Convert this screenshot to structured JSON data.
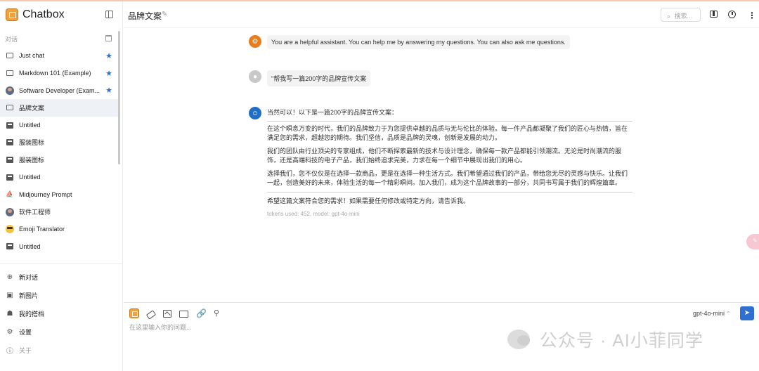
{
  "app": {
    "name": "Chatbox"
  },
  "sidebar": {
    "section_label": "对话",
    "conversations": [
      {
        "label": "Just chat",
        "icon": "chat-bubble-icon",
        "starred": true,
        "active": false
      },
      {
        "label": "Markdown 101 (Example)",
        "icon": "chat-bubble-icon",
        "starred": true,
        "active": false
      },
      {
        "label": "Software Developer (Exam...",
        "icon": "avatar-icon",
        "starred": true,
        "active": false
      },
      {
        "label": "品牌文案",
        "icon": "chat-bubble-icon",
        "starred": false,
        "active": true
      },
      {
        "label": "Untitled",
        "icon": "image-icon",
        "starred": false,
        "active": false
      },
      {
        "label": "服装图标",
        "icon": "image-icon",
        "starred": false,
        "active": false
      },
      {
        "label": "服装图标",
        "icon": "image-icon",
        "starred": false,
        "active": false
      },
      {
        "label": "Untitled",
        "icon": "image-icon",
        "starred": false,
        "active": false
      },
      {
        "label": "Midjourney Prompt",
        "icon": "midjourney-icon",
        "starred": false,
        "active": false
      },
      {
        "label": "软件工程师",
        "icon": "avatar-icon",
        "starred": false,
        "active": false
      },
      {
        "label": "Emoji Translator",
        "icon": "emoji-icon",
        "starred": false,
        "active": false
      },
      {
        "label": "Untitled",
        "icon": "image-icon",
        "starred": false,
        "active": false
      }
    ],
    "menu": {
      "new_chat": "新对话",
      "new_image": "新图片",
      "my_partners": "我的搭档",
      "settings": "设置",
      "about": "关于"
    }
  },
  "header": {
    "title": "品牌文案",
    "search_placeholder": "搜索..."
  },
  "messages": {
    "system": "You are a helpful assistant. You can help me by answering my questions. You can also ask me questions.",
    "user": "\"帮我写一篇200字的品牌宣传文案",
    "assistant": {
      "intro": "当然可以！以下是一篇200字的品牌宣传文案：",
      "paragraphs": [
        "在这个瞬息万变的时代，我们的品牌致力于为您提供卓越的品质与无与伦比的体验。每一件产品都凝聚了我们的匠心与热情，旨在满足您的需求，超越您的期待。我们坚信，品质是品牌的灵魂，创新是发展的动力。",
        "我们的团队由行业顶尖的专家组成，他们不断探索最新的技术与设计理念，确保每一款产品都能引领潮流。无论是时尚潮流的服饰，还是高端科技的电子产品，我们始终追求完美，力求在每一个细节中展现出我们的用心。",
        "选择我们，您不仅仅是在选择一款商品，更是在选择一种生活方式。我们希望通过我们的产品，带给您无尽的灵感与快乐。让我们一起，创造美好的未来，体验生活的每一个精彩瞬间。加入我们，成为这个品牌故事的一部分，共同书写属于我们的辉煌篇章。"
      ],
      "outro": "希望这篇文案符合您的需求！如果需要任何修改或特定方向，请告诉我。",
      "tokens": "tokens used: 452, model: gpt-4o-mini"
    }
  },
  "input": {
    "placeholder": "在这里输入你的问题...",
    "model": "gpt-4o-mini"
  },
  "watermark": {
    "text": "公众号 · AI小菲同学"
  },
  "colors": {
    "accent": "#2f6fd1",
    "system_avatar": "#e87d1e",
    "bot_avatar": "#1f6fc5",
    "active_item_bg": "#eef2f7"
  }
}
